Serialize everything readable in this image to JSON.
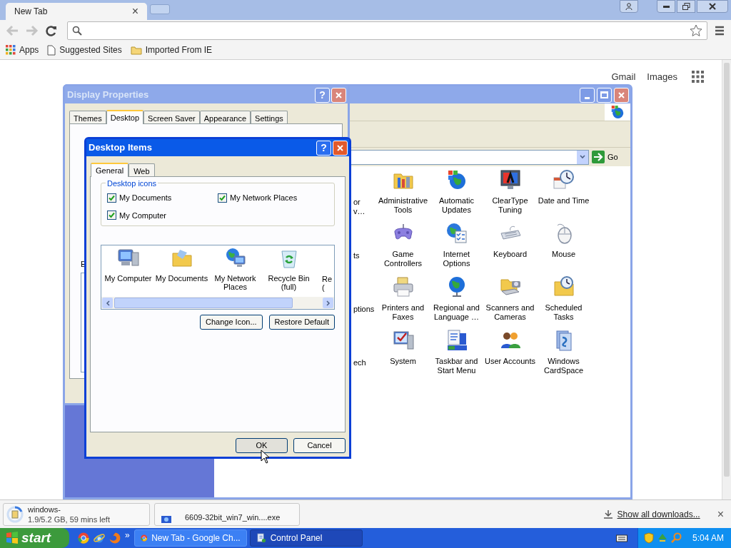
{
  "browser": {
    "tab": {
      "title": "New Tab",
      "close": "×"
    },
    "bookmarks": [
      {
        "label": "Apps"
      },
      {
        "label": "Suggested Sites"
      },
      {
        "label": "Imported From IE"
      }
    ],
    "page_links": [
      "Gmail",
      "Images"
    ]
  },
  "control_panel": {
    "go": "Go",
    "items": [
      {
        "label": "or\nv…",
        "kind": "clipped"
      },
      {
        "label": "Administrative\nTools",
        "kind": "item"
      },
      {
        "label": "Automatic\nUpdates",
        "kind": "item"
      },
      {
        "label": "ClearType\nTuning",
        "kind": "item"
      },
      {
        "label": "Date and Time",
        "kind": "item"
      },
      {
        "label": "ts",
        "kind": "clipped"
      },
      {
        "label": "Game\nControllers",
        "kind": "item"
      },
      {
        "label": "Internet\nOptions",
        "kind": "item"
      },
      {
        "label": "Keyboard",
        "kind": "item"
      },
      {
        "label": "Mouse",
        "kind": "item"
      },
      {
        "label": "ptions",
        "kind": "clipped"
      },
      {
        "label": "Printers and\nFaxes",
        "kind": "item"
      },
      {
        "label": "Regional and\nLanguage …",
        "kind": "item"
      },
      {
        "label": "Scanners and\nCameras",
        "kind": "item"
      },
      {
        "label": "Scheduled\nTasks",
        "kind": "item"
      },
      {
        "label": "ech",
        "kind": "clipped"
      },
      {
        "label": "System",
        "kind": "item"
      },
      {
        "label": "Taskbar and\nStart Menu",
        "kind": "item"
      },
      {
        "label": "User Accounts",
        "kind": "item"
      },
      {
        "label": "Windows\nCardSpace",
        "kind": "item"
      }
    ]
  },
  "display_properties": {
    "title": "Display Properties",
    "help": "?",
    "tabs": [
      {
        "label": "Themes",
        "selected": false
      },
      {
        "label": "Desktop",
        "selected": true
      },
      {
        "label": "Screen Saver",
        "selected": false
      },
      {
        "label": "Appearance",
        "selected": false
      },
      {
        "label": "Settings",
        "selected": false
      }
    ],
    "fragment": "E"
  },
  "desktop_items": {
    "title": "Desktop Items",
    "help": "?",
    "tabs": [
      {
        "label": "General",
        "selected": true
      },
      {
        "label": "Web",
        "selected": false
      }
    ],
    "group_title": "Desktop icons",
    "checkboxes": [
      {
        "label": "My Documents",
        "checked": true
      },
      {
        "label": "My Network Places",
        "checked": true
      },
      {
        "label": "My Computer",
        "checked": true
      }
    ],
    "icons": [
      {
        "label": "My Computer",
        "kind": "item"
      },
      {
        "label": "My Documents",
        "kind": "item"
      },
      {
        "label": "My Network\nPlaces",
        "kind": "item"
      },
      {
        "label": "Recycle Bin\n(full)",
        "kind": "item"
      },
      {
        "label": "Re\n(",
        "kind": "clipped"
      }
    ],
    "buttons": [
      "Change Icon...",
      "Restore Default"
    ],
    "footer_buttons": [
      "OK",
      "Cancel"
    ]
  },
  "downloads": {
    "items": [
      {
        "name": "windows-",
        "status": "1.9/5.2 GB, 59 mins left"
      },
      {
        "name": "6609-32bit_win7_win....exe"
      }
    ],
    "show_all": "Show all downloads...",
    "close": "×"
  },
  "taskbar": {
    "start": "start",
    "overflow": "»",
    "tasks": [
      {
        "label": "New Tab - Google Ch...",
        "selected": false
      },
      {
        "label": "Control Panel",
        "selected": true
      }
    ],
    "clock": "5:04 AM"
  }
}
